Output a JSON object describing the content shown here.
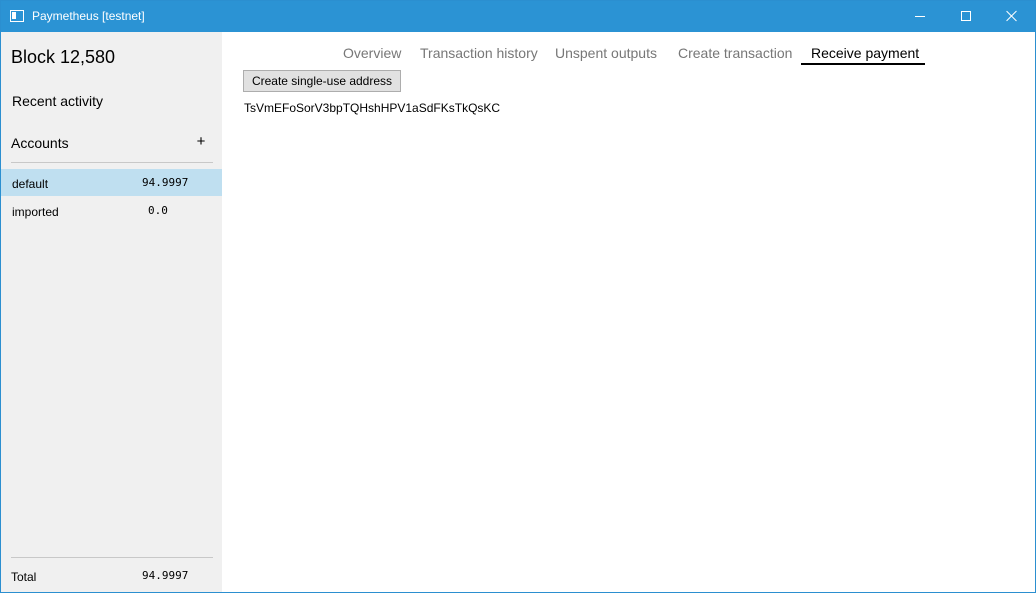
{
  "window": {
    "title": "Paymetheus [testnet]",
    "controls": {
      "minimize": "minimize",
      "maximize": "maximize",
      "close": "close"
    }
  },
  "sidebar": {
    "block_label": "Block 12,580",
    "recent_activity_label": "Recent activity",
    "accounts_label": "Accounts",
    "add_account_label": "+",
    "accounts": [
      {
        "name": "default",
        "balance": "94.9997",
        "selected": true
      },
      {
        "name": "imported",
        "balance": "0.0",
        "selected": false
      }
    ],
    "total_label": "Total",
    "total_value": "94.9997"
  },
  "tabs": [
    {
      "label": "Overview",
      "active": false
    },
    {
      "label": "Transaction history",
      "active": false
    },
    {
      "label": "Unspent outputs",
      "active": false
    },
    {
      "label": "Create transaction",
      "active": false
    },
    {
      "label": "Receive payment",
      "active": true
    }
  ],
  "receive": {
    "create_button_label": "Create single-use address",
    "address": "TsVmEFoSorV3bpTQHshHPV1aSdFKsTkQsKC"
  },
  "colors": {
    "titlebar": "#2b93d4",
    "sidebar_bg": "#f0f0f0",
    "selected_row": "#bfdff0",
    "inactive_tab": "#777777"
  }
}
